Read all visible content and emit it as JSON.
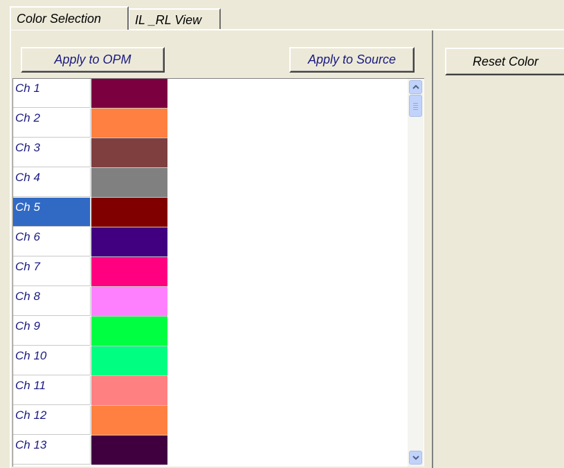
{
  "tabs": [
    {
      "label": "Color Selection",
      "active": true
    },
    {
      "label": "IL _RL View",
      "active": false
    }
  ],
  "buttons": {
    "apply_opm": "Apply to OPM",
    "apply_source": "Apply to Source",
    "reset_color": "Reset Color"
  },
  "channels": [
    {
      "label": "Ch 1",
      "color": "#7a0040"
    },
    {
      "label": "Ch 2",
      "color": "#ff8040"
    },
    {
      "label": "Ch 3",
      "color": "#7f3f3f"
    },
    {
      "label": "Ch 4",
      "color": "#808080"
    },
    {
      "label": "Ch 5",
      "color": "#800000",
      "selected": true
    },
    {
      "label": "Ch 6",
      "color": "#400080"
    },
    {
      "label": "Ch 7",
      "color": "#ff0080"
    },
    {
      "label": "Ch 8",
      "color": "#ff80ff"
    },
    {
      "label": "Ch 9",
      "color": "#00ff40"
    },
    {
      "label": "Ch 10",
      "color": "#00ff80"
    },
    {
      "label": "Ch 11",
      "color": "#ff8080"
    },
    {
      "label": "Ch 12",
      "color": "#ff8040"
    },
    {
      "label": "Ch 13",
      "color": "#400040"
    }
  ],
  "scrollbar": {
    "up_icon": "scroll-up-arrow-icon",
    "down_icon": "scroll-down-arrow-icon"
  }
}
